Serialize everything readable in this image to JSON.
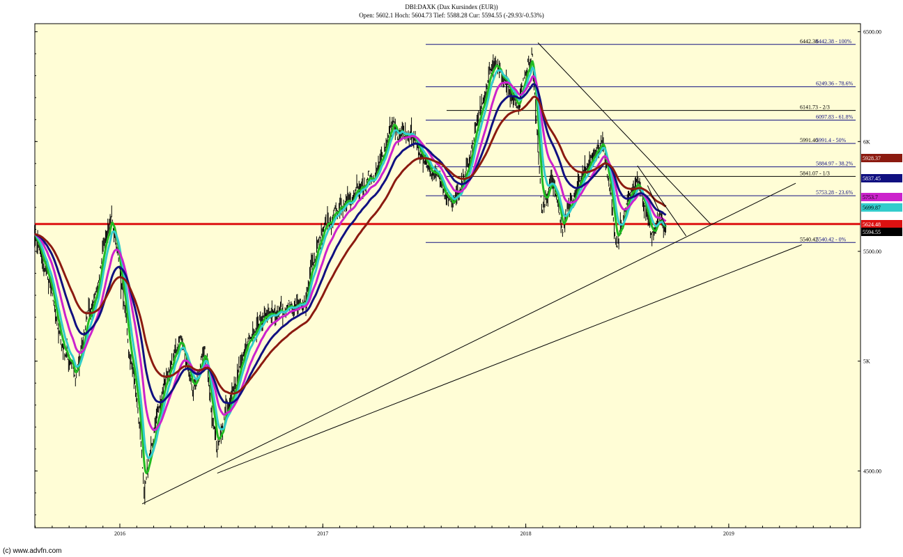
{
  "header": {
    "title": "DBI:DAXK (Dax Kursindex (EUR))",
    "subtitle": "Open: 5602.1 Hoch: 5604.73 Tief: 5588.28 Cur: 5594.55 (-29.93/-0.53%)"
  },
  "footer": {
    "credit": "(c) www.advfn.com"
  },
  "colors": {
    "plot_bg": "#fffdd6",
    "price": "#000000",
    "ma_green": "#22bb22",
    "ma_cyan": "#33cccc",
    "ma_magenta": "#cc22cc",
    "ma_navy": "#101080",
    "ma_brown": "#8b1a10",
    "fib": "#101080",
    "support": "#dd1111"
  },
  "chart_data": {
    "type": "line",
    "x_ticks": [
      "2016",
      "2017",
      "2018",
      "2019"
    ],
    "y_ticks": [
      "6500.00",
      "6K",
      "5500.00",
      "5K",
      "4500.00"
    ],
    "ylim": [
      4250,
      6520
    ],
    "price_anchors": [
      {
        "t": 2015.58,
        "v": 5600
      },
      {
        "t": 2015.66,
        "v": 5350
      },
      {
        "t": 2015.72,
        "v": 5050
      },
      {
        "t": 2015.78,
        "v": 4900
      },
      {
        "t": 2015.86,
        "v": 5250
      },
      {
        "t": 2015.92,
        "v": 5500
      },
      {
        "t": 2015.96,
        "v": 5650
      },
      {
        "t": 2016.0,
        "v": 5400
      },
      {
        "t": 2016.05,
        "v": 5050
      },
      {
        "t": 2016.1,
        "v": 4700
      },
      {
        "t": 2016.12,
        "v": 4400
      },
      {
        "t": 2016.15,
        "v": 4600
      },
      {
        "t": 2016.22,
        "v": 4900
      },
      {
        "t": 2016.3,
        "v": 5100
      },
      {
        "t": 2016.36,
        "v": 4850
      },
      {
        "t": 2016.42,
        "v": 5050
      },
      {
        "t": 2016.48,
        "v": 4550
      },
      {
        "t": 2016.52,
        "v": 4750
      },
      {
        "t": 2016.58,
        "v": 4950
      },
      {
        "t": 2016.65,
        "v": 5150
      },
      {
        "t": 2016.75,
        "v": 5200
      },
      {
        "t": 2016.85,
        "v": 5250
      },
      {
        "t": 2016.92,
        "v": 5300
      },
      {
        "t": 2016.97,
        "v": 5550
      },
      {
        "t": 2017.05,
        "v": 5650
      },
      {
        "t": 2017.15,
        "v": 5750
      },
      {
        "t": 2017.25,
        "v": 5850
      },
      {
        "t": 2017.35,
        "v": 6050
      },
      {
        "t": 2017.45,
        "v": 6020
      },
      {
        "t": 2017.55,
        "v": 5850
      },
      {
        "t": 2017.63,
        "v": 5700
      },
      {
        "t": 2017.7,
        "v": 5830
      },
      {
        "t": 2017.78,
        "v": 6150
      },
      {
        "t": 2017.84,
        "v": 6350
      },
      {
        "t": 2017.9,
        "v": 6250
      },
      {
        "t": 2017.96,
        "v": 6150
      },
      {
        "t": 2018.03,
        "v": 6400
      },
      {
        "t": 2018.08,
        "v": 5700
      },
      {
        "t": 2018.13,
        "v": 5850
      },
      {
        "t": 2018.18,
        "v": 5600
      },
      {
        "t": 2018.25,
        "v": 5800
      },
      {
        "t": 2018.33,
        "v": 5950
      },
      {
        "t": 2018.38,
        "v": 6000
      },
      {
        "t": 2018.45,
        "v": 5550
      },
      {
        "t": 2018.52,
        "v": 5800
      },
      {
        "t": 2018.56,
        "v": 5800
      },
      {
        "t": 2018.62,
        "v": 5550
      },
      {
        "t": 2018.66,
        "v": 5650
      },
      {
        "t": 2018.69,
        "v": 5594.55
      }
    ],
    "series": [
      {
        "label": "5928.37",
        "color": "#8b1a10",
        "span": 85,
        "last": 5928.37
      },
      {
        "label": "5837.45",
        "color": "#101080",
        "span": 50,
        "last": 5837.45
      },
      {
        "label": "5753.7",
        "color": "#cc22cc",
        "span": 28,
        "last": 5753.7
      },
      {
        "label": "5699.87",
        "color": "#33cccc",
        "span": 13,
        "last": 5699.87
      },
      {
        "label": "5699.87",
        "color": "#22bb22",
        "span": 7,
        "last": 5705
      },
      {
        "label": "5624.48",
        "color": "#dd1111",
        "last": 5624.48
      },
      {
        "label": "5594.55",
        "color": "#000000",
        "last": 5594.55
      }
    ],
    "fibonacci": [
      {
        "value": 6442.38,
        "label": "6442.38",
        "label2": "6442.38 - 100%",
        "color": "#101080"
      },
      {
        "value": 6249.36,
        "label": "6249.36 - 78.6%",
        "color": "#101080"
      },
      {
        "value": 6141.73,
        "label": "6141.73 - 2/3",
        "color": "#000000"
      },
      {
        "value": 6097.83,
        "label": "6097.83 - 61.8%",
        "color": "#101080"
      },
      {
        "value": 5991.4,
        "label": "5991.40",
        "label2": "5991.4 - 50%",
        "color": "#101080"
      },
      {
        "value": 5884.97,
        "label": "5884.97 - 38.2%",
        "color": "#101080"
      },
      {
        "value": 5841.07,
        "label": "5841.07 - 1/3",
        "color": "#000000"
      },
      {
        "value": 5753.28,
        "label": "5753.28 - 23.6%",
        "color": "#101080"
      },
      {
        "value": 5540.42,
        "label": "5540.42",
        "label2": "5540.42 - 0%",
        "color": "#101080"
      }
    ],
    "support_level": 5624.48,
    "trendlines": [
      {
        "t1": 2016.11,
        "v1": 4350,
        "t2": 2019.33,
        "v2": 5810
      },
      {
        "t1": 2016.48,
        "v1": 4490,
        "t2": 2019.36,
        "v2": 5530
      },
      {
        "t1": 2018.06,
        "v1": 6450,
        "t2": 2018.91,
        "v2": 5625
      },
      {
        "t1": 2018.55,
        "v1": 5890,
        "t2": 2018.79,
        "v2": 5570
      },
      {
        "t1": 2018.6,
        "v1": 5800,
        "t2": 2018.69,
        "v2": 5615
      }
    ],
    "grid": false
  }
}
